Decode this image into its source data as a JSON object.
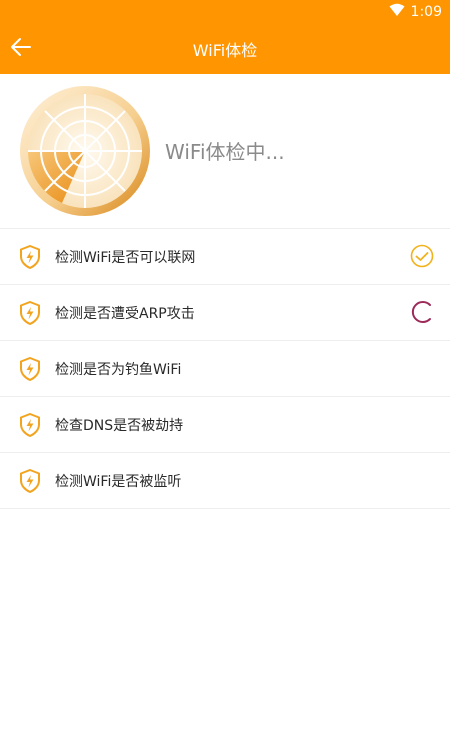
{
  "statusbar": {
    "time": "1:09",
    "wifi_icon": "wifi-icon"
  },
  "header": {
    "title": "WiFi体检",
    "back_icon": "arrow-left-icon"
  },
  "scan": {
    "status_text": "WiFi体检中..."
  },
  "checks": [
    {
      "label": "检测WiFi是否可以联网",
      "state": "done"
    },
    {
      "label": "检测是否遭受ARP攻击",
      "state": "loading"
    },
    {
      "label": "检测是否为钓鱼WiFi",
      "state": "pending"
    },
    {
      "label": "检查DNS是否被劫持",
      "state": "pending"
    },
    {
      "label": "检测WiFi是否被监听",
      "state": "pending"
    }
  ],
  "colors": {
    "accent": "#ff9500",
    "done": "#f2b21b",
    "loading": "#9c2b5a"
  }
}
